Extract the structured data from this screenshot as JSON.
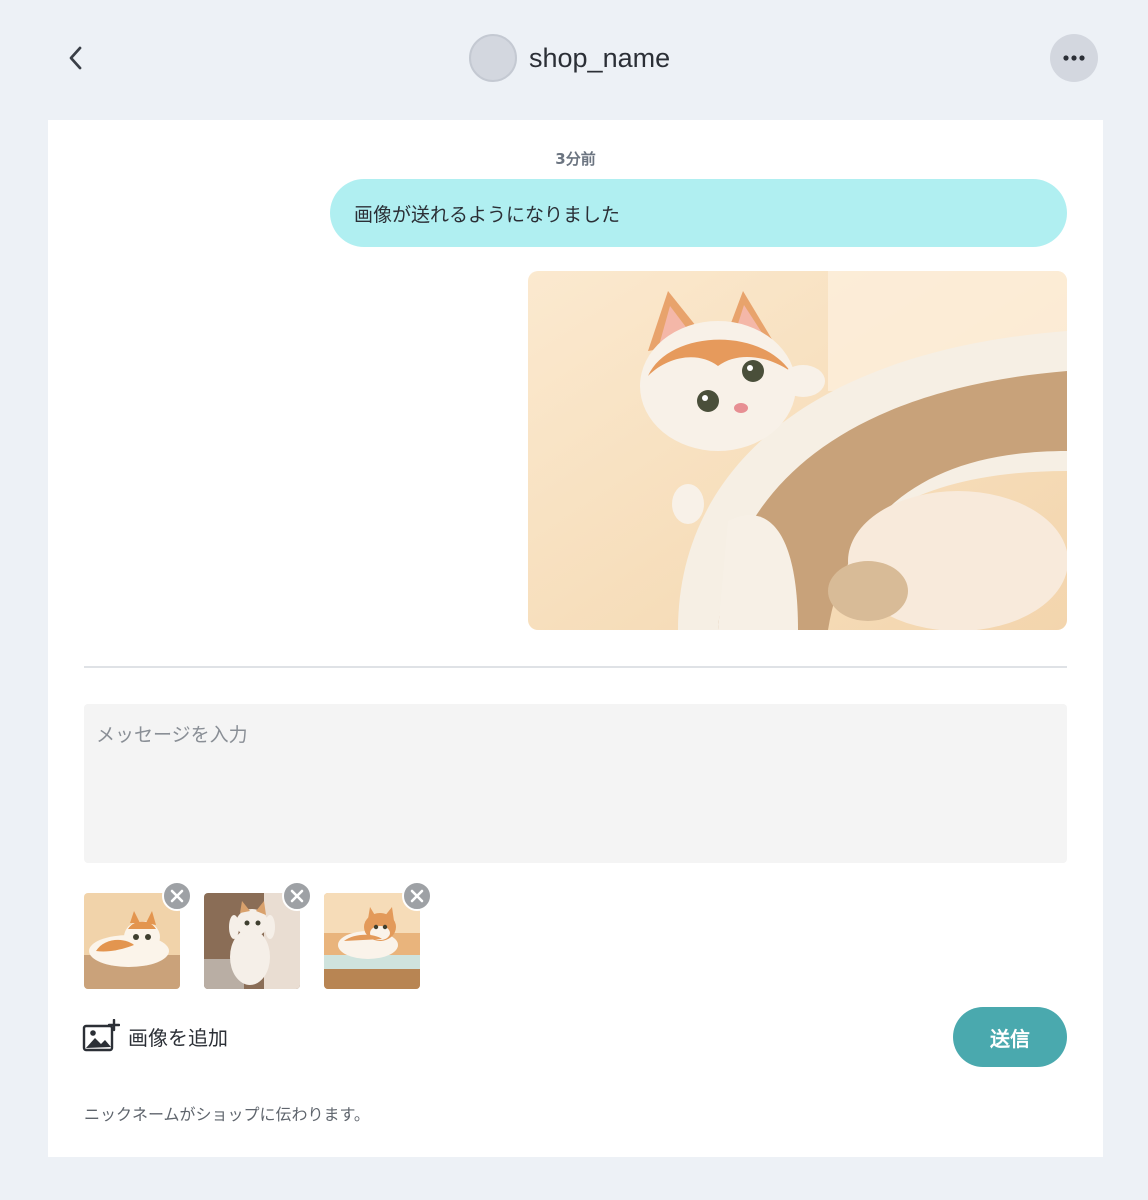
{
  "header": {
    "shop_name": "shop_name",
    "back_icon": "chevron-left-icon",
    "more_icon": "ellipsis-icon"
  },
  "chat": {
    "timestamp": "3分前",
    "message": "画像が送れるようになりました",
    "image_subject": "cat-on-cat-tower-photo"
  },
  "composer": {
    "placeholder": "メッセージを入力",
    "value": "",
    "attachments": [
      {
        "subject": "cat-lying-on-floor-photo"
      },
      {
        "subject": "cat-reaching-up-photo"
      },
      {
        "subject": "cat-on-glass-table-photo"
      }
    ],
    "add_image_label": "画像を追加",
    "send_label": "送信",
    "note": "ニックネームがショップに伝わります。"
  },
  "colors": {
    "background": "#edf1f6",
    "bubble": "#b0eff1",
    "send_button": "#4aa9ae",
    "input_background": "#f4f4f4"
  }
}
